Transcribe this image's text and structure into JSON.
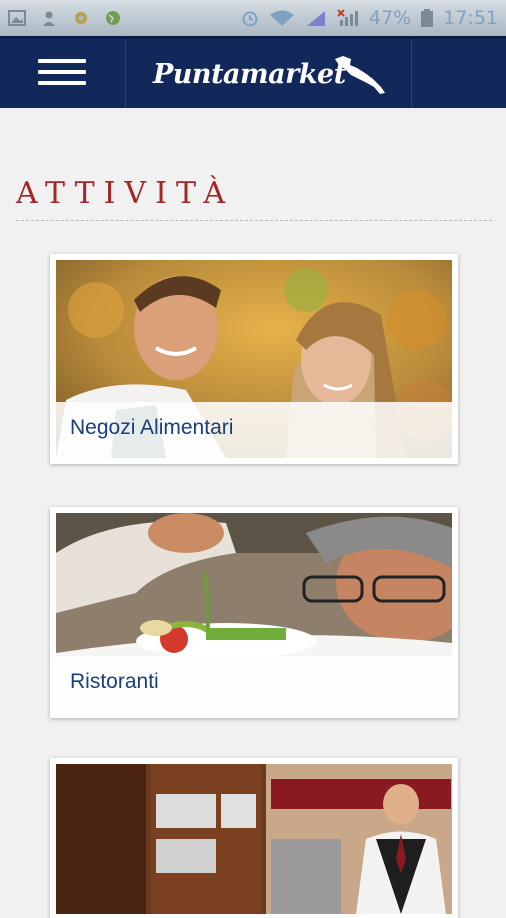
{
  "status_bar": {
    "battery": "47%",
    "time": "17:51"
  },
  "header": {
    "logo_text": "Puntamarket",
    "menu_icon": "hamburger-icon"
  },
  "section": {
    "title": "ATTIVITÀ"
  },
  "cards": [
    {
      "label": "Negozi Alimentari"
    },
    {
      "label": "Ristoranti"
    },
    {
      "label": ""
    }
  ],
  "colors": {
    "navbar": "#12275a",
    "title_red": "#a12626",
    "card_label": "#1c3f7a",
    "background": "#f1f1f1"
  }
}
